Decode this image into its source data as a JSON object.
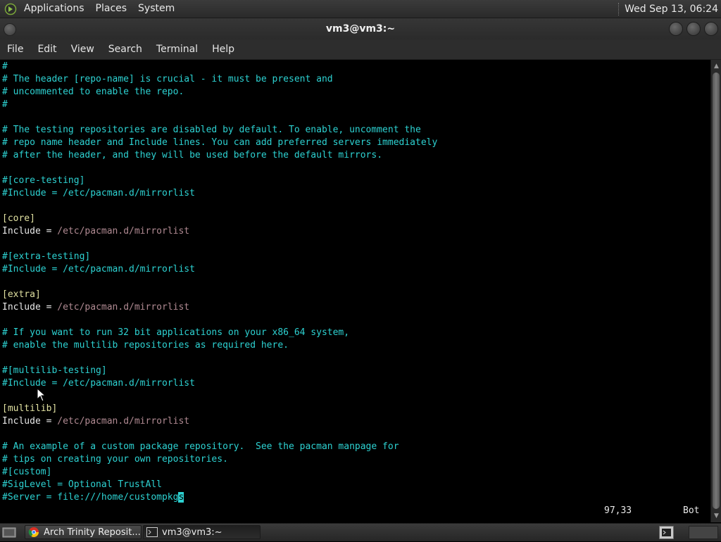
{
  "top_panel": {
    "menus": [
      "Applications",
      "Places",
      "System"
    ],
    "clock": "Wed Sep 13, 06:24"
  },
  "window": {
    "title": "vm3@vm3:~",
    "menu": [
      "File",
      "Edit",
      "View",
      "Search",
      "Terminal",
      "Help"
    ]
  },
  "colors": {
    "comment": "#2dd2d2",
    "section": "#e0e0a0",
    "keyword": "#e8e8e8",
    "path": "#b08a92",
    "background": "#000000"
  },
  "terminal": {
    "lines": [
      [
        {
          "t": "#",
          "c": "comment"
        }
      ],
      [
        {
          "t": "# The header [repo-name] is crucial - it must be present and",
          "c": "comment"
        }
      ],
      [
        {
          "t": "# uncommented to enable the repo.",
          "c": "comment"
        }
      ],
      [
        {
          "t": "#",
          "c": "comment"
        }
      ],
      [],
      [
        {
          "t": "# The testing repositories are disabled by default. To enable, uncomment the",
          "c": "comment"
        }
      ],
      [
        {
          "t": "# repo name header and Include lines. You can add preferred servers immediately",
          "c": "comment"
        }
      ],
      [
        {
          "t": "# after the header, and they will be used before the default mirrors.",
          "c": "comment"
        }
      ],
      [],
      [
        {
          "t": "#[core-testing]",
          "c": "comment"
        }
      ],
      [
        {
          "t": "#Include = /etc/pacman.d/mirrorlist",
          "c": "comment"
        }
      ],
      [],
      [
        {
          "t": "[core]",
          "c": "section"
        }
      ],
      [
        {
          "t": "Include = ",
          "c": "white"
        },
        {
          "t": "/etc/pacman.d/mirrorlist",
          "c": "path"
        }
      ],
      [],
      [
        {
          "t": "#[extra-testing]",
          "c": "comment"
        }
      ],
      [
        {
          "t": "#Include = /etc/pacman.d/mirrorlist",
          "c": "comment"
        }
      ],
      [],
      [
        {
          "t": "[extra]",
          "c": "section"
        }
      ],
      [
        {
          "t": "Include = ",
          "c": "white"
        },
        {
          "t": "/etc/pacman.d/mirrorlist",
          "c": "path"
        }
      ],
      [],
      [
        {
          "t": "# If you want to run 32 bit applications on your x86_64 system,",
          "c": "comment"
        }
      ],
      [
        {
          "t": "# enable the multilib repositories as required here.",
          "c": "comment"
        }
      ],
      [],
      [
        {
          "t": "#[multilib-testing]",
          "c": "comment"
        }
      ],
      [
        {
          "t": "#Include = /etc/pacman.d/mirrorlist",
          "c": "comment"
        }
      ],
      [],
      [
        {
          "t": "[multilib]",
          "c": "section"
        }
      ],
      [
        {
          "t": "Include = ",
          "c": "white"
        },
        {
          "t": "/etc/pacman.d/mirrorlist",
          "c": "path"
        }
      ],
      [],
      [
        {
          "t": "# An example of a custom package repository.  See the pacman manpage for",
          "c": "comment"
        }
      ],
      [
        {
          "t": "# tips on creating your own repositories.",
          "c": "comment"
        }
      ],
      [
        {
          "t": "#[custom]",
          "c": "comment"
        }
      ],
      [
        {
          "t": "#SigLevel = Optional TrustAll",
          "c": "comment"
        }
      ],
      [
        {
          "t": "#Server = file:///home/custompkg",
          "c": "comment"
        },
        {
          "t": "s",
          "c": "cursor"
        }
      ]
    ],
    "status_position": "97,33",
    "status_scroll": "Bot"
  },
  "taskbar": {
    "tasks": [
      {
        "label": "Arch Trinity Reposit...",
        "icon": "chrome-icon",
        "active": false
      },
      {
        "label": "vm3@vm3:~",
        "icon": "terminal-icon",
        "active": true
      }
    ]
  }
}
